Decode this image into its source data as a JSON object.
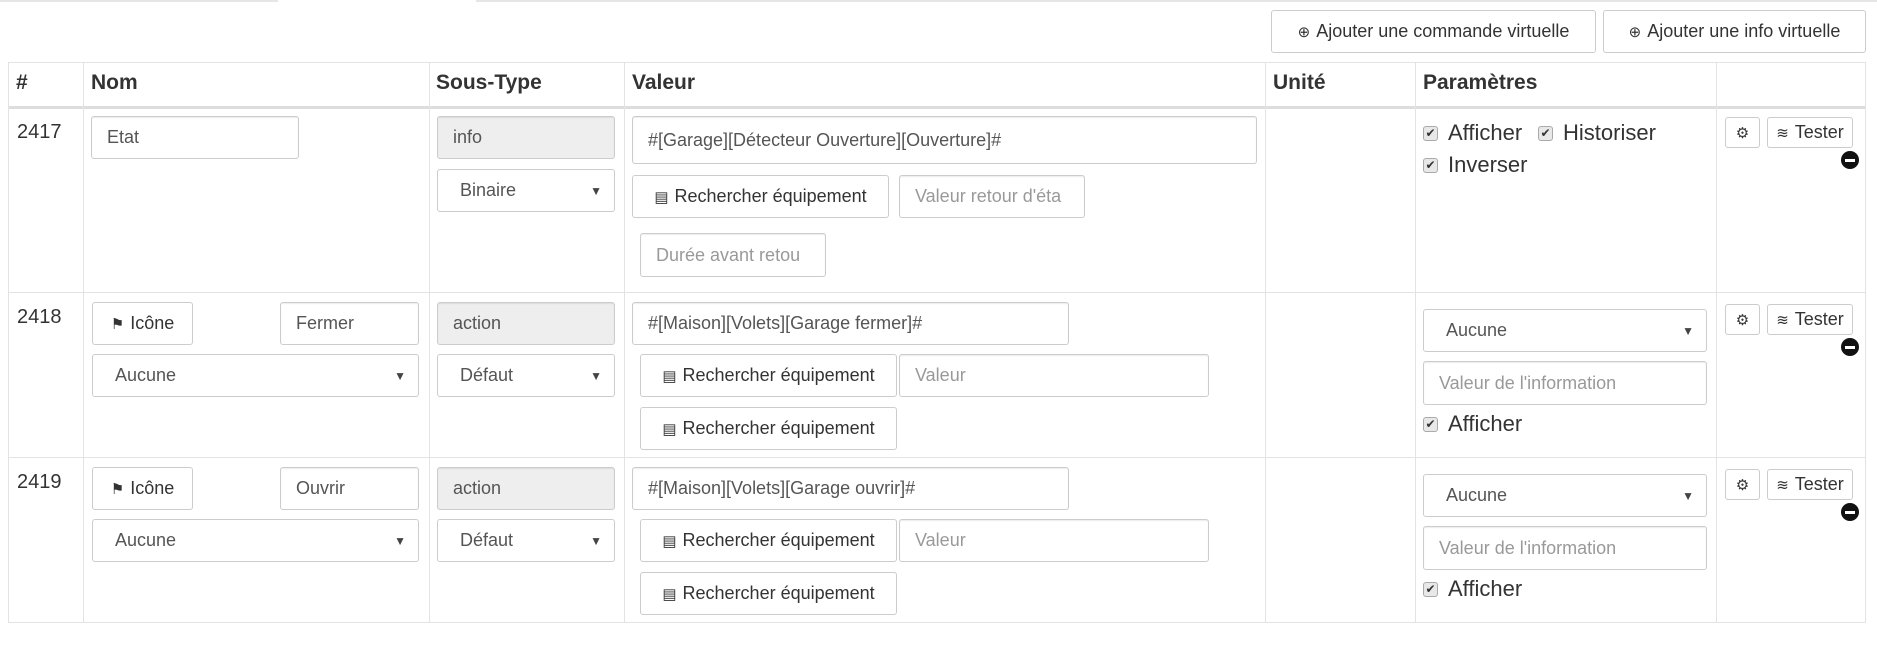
{
  "toolbar": {
    "add_command": "Ajouter une commande virtuelle",
    "add_info": "Ajouter une info virtuelle"
  },
  "table": {
    "headers": [
      "#",
      "Nom",
      "Sous-Type",
      "Valeur",
      "Unité",
      "Paramètres"
    ]
  },
  "rows": [
    {
      "id": "2417",
      "name": "Etat",
      "type": "info",
      "subtype": "Binaire",
      "value": "#[Garage][Détecteur Ouverture][Ouverture]#",
      "search": "Rechercher équipement",
      "return_placeholder": "Valeur retour d'éta",
      "duration_placeholder": "Durée avant retou",
      "params": {
        "afficher": "Afficher",
        "historiser": "Historiser",
        "inverser": "Inverser"
      },
      "test": "Tester"
    },
    {
      "id": "2418",
      "icon_btn": "Icône",
      "name": "Fermer",
      "select": "Aucune",
      "type": "action",
      "subtype": "Défaut",
      "value": "#[Maison][Volets][Garage fermer]#",
      "search": "Rechercher équipement",
      "value_placeholder": "Valeur",
      "search2": "Rechercher équipement",
      "param_select": "Aucune",
      "param_placeholder": "Valeur de l'information",
      "afficher": "Afficher",
      "test": "Tester"
    },
    {
      "id": "2419",
      "icon_btn": "Icône",
      "name": "Ouvrir",
      "select": "Aucune",
      "type": "action",
      "subtype": "Défaut",
      "value": "#[Maison][Volets][Garage ouvrir]#",
      "search": "Rechercher équipement",
      "value_placeholder": "Valeur",
      "search2": "Rechercher équipement",
      "param_select": "Aucune",
      "param_placeholder": "Valeur de l'information",
      "afficher": "Afficher",
      "test": "Tester"
    }
  ]
}
